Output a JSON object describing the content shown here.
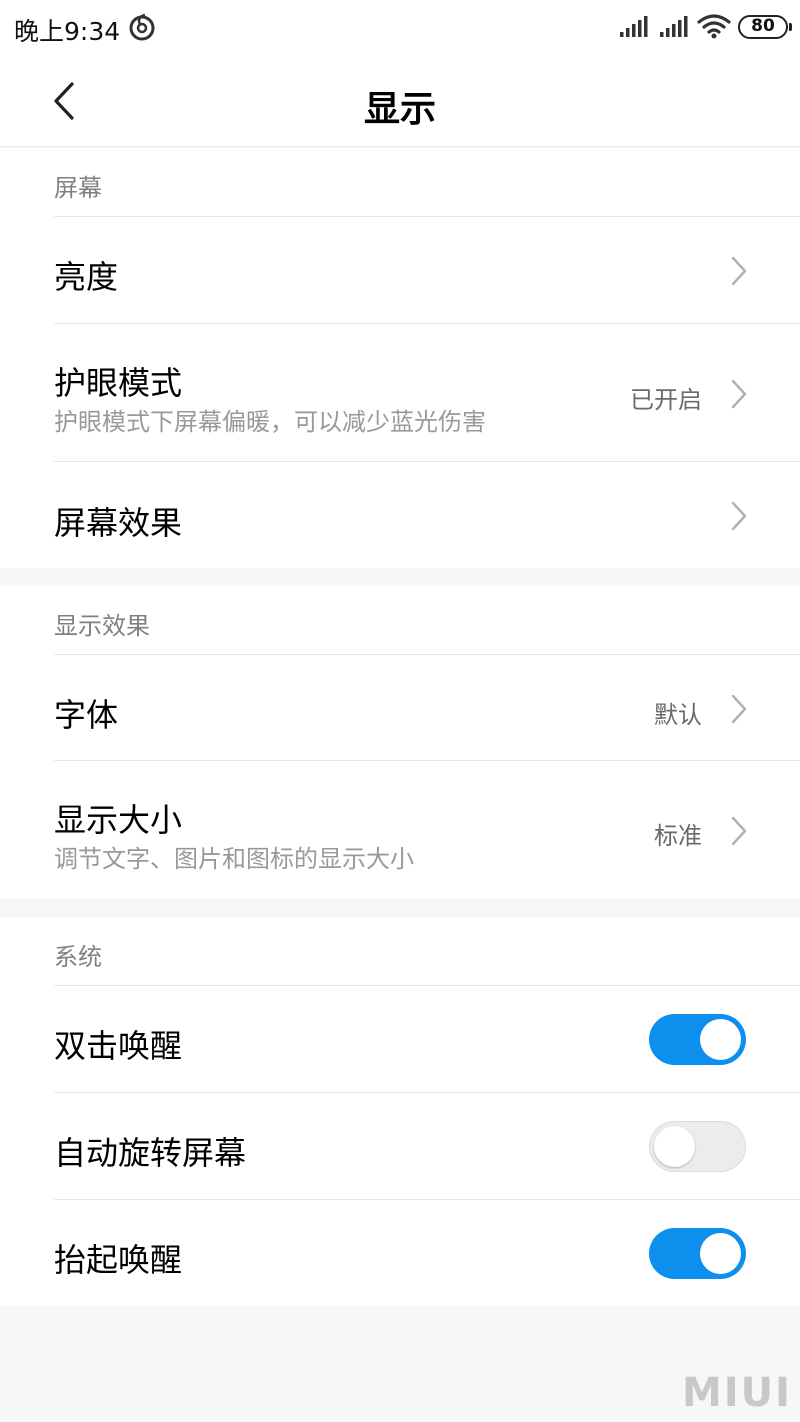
{
  "status_bar": {
    "time": "晚上9:34",
    "app_icon": "netease-music-icon",
    "signal_icons": [
      "signal-icon",
      "signal-icon"
    ],
    "wifi_icon": "wifi-icon",
    "battery": "80"
  },
  "header": {
    "back_icon": "chevron-left-icon",
    "title": "显示"
  },
  "sections": [
    {
      "header": "屏幕",
      "rows": [
        {
          "title": "亮度",
          "icon": "chevron-right-icon"
        },
        {
          "title": "护眼模式",
          "subtitle": "护眼模式下屏幕偏暖，可以减少蓝光伤害",
          "value": "已开启",
          "icon": "chevron-right-icon"
        },
        {
          "title": "屏幕效果",
          "icon": "chevron-right-icon"
        }
      ]
    },
    {
      "header": "显示效果",
      "rows": [
        {
          "title": "字体",
          "value": "默认",
          "icon": "chevron-right-icon"
        },
        {
          "title": "显示大小",
          "subtitle": "调节文字、图片和图标的显示大小",
          "value": "标准",
          "icon": "chevron-right-icon"
        }
      ]
    },
    {
      "header": "系统",
      "rows": [
        {
          "title": "双击唤醒",
          "toggle": true
        },
        {
          "title": "自动旋转屏幕",
          "toggle": false
        },
        {
          "title": "抬起唤醒",
          "toggle": true
        }
      ]
    }
  ],
  "colors": {
    "toggle_on": "#0d8fee",
    "toggle_off": "#ececec",
    "secondary_text": "#999999",
    "page_background": "#f7f7f7"
  },
  "watermark": "MIUI"
}
